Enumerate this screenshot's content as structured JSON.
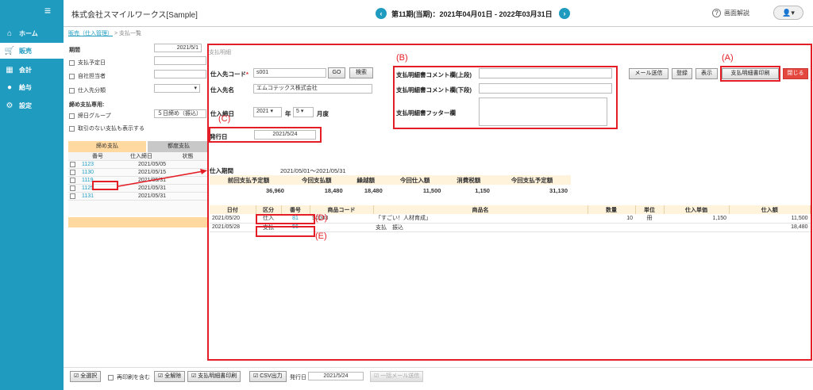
{
  "sidebar": {
    "menu_icon": "hamburger-icon",
    "items": [
      {
        "label": "ホーム",
        "icon": "home-icon"
      },
      {
        "label": "販売",
        "icon": "cart-icon"
      },
      {
        "label": "会計",
        "icon": "calculator-icon"
      },
      {
        "label": "給与",
        "icon": "moneybag-icon"
      },
      {
        "label": "設定",
        "icon": "gear-icon"
      }
    ]
  },
  "header": {
    "company": "株式会社スマイルワークス[Sample]",
    "period": "第11期(当期)：2021年04月01日 - 2022年03月31日",
    "help": "画面解説"
  },
  "breadcrumb": {
    "link": "販売（仕入管理）",
    "sep": " > ",
    "current": "支払一覧"
  },
  "filters": {
    "period_label": "期間",
    "period_value": "2021/5/1",
    "due_date_label": "支払予定日",
    "staff_label": "自社担当者",
    "category_label": "仕入先分類",
    "closing_heading": "締め支払専用:",
    "closing_group_label": "締日グループ",
    "closing_group_value": "５日締め（振込）",
    "show_no_trans_label": "取引のない支払も表示する"
  },
  "left_list": {
    "tab_active": "締め支払",
    "tab_inactive": "都度支払",
    "headers": [
      "番号",
      "仕入締日",
      "状態"
    ],
    "rows": [
      {
        "no": "1123",
        "date": "2021/05/05"
      },
      {
        "no": "1130",
        "date": "2021/05/15"
      },
      {
        "no": "1119",
        "date": "2021/05/31"
      },
      {
        "no": "1125",
        "date": "2021/05/31"
      },
      {
        "no": "1131",
        "date": "2021/05/31"
      }
    ]
  },
  "modal": {
    "title": "支払明細",
    "supplier_code_label": "仕入先コード",
    "required_mark": "*",
    "supplier_code": "s001",
    "go_btn": "GO",
    "search_btn": "検索",
    "supplier_name_label": "仕入先名",
    "supplier_name": "エムコテックス株式会社",
    "closing_label": "仕入締日",
    "year": "2021",
    "year_unit": "年",
    "month": "5",
    "month_unit": "月度",
    "issue_label": "発行日",
    "issue_date": "2021/5/24",
    "comment_upper_label": "支払明細書コメント欄(上段)",
    "comment_lower_label": "支払明細書コメント欄(下段)",
    "footer_label": "支払明細書フッター欄",
    "buttons": {
      "mail": "メール送信",
      "register": "登録",
      "display": "表示",
      "print": "支払明細書印刷",
      "close": "閉じる"
    },
    "purchase_period_label": "仕入期間",
    "purchase_period": "2021/05/01～2021/05/31",
    "summary": {
      "headers": [
        "前回支払予定額",
        "今回支払額",
        "繰越額",
        "今回仕入額",
        "消費税額",
        "今回支払予定額"
      ],
      "values": [
        "36,960",
        "18,480",
        "18,480",
        "11,500",
        "1,150",
        "31,130"
      ]
    },
    "detail": {
      "headers": [
        "日付",
        "区分",
        "番号",
        "商品コード",
        "商品名",
        "数量",
        "単位",
        "仕入単価",
        "仕入額"
      ],
      "rows": [
        {
          "date": "2021/05/20",
          "kind": "仕入",
          "no": "81",
          "code": "S0003",
          "name": "「すごい！人材育成」",
          "qty": "10",
          "unit": "冊",
          "price": "1,150",
          "amount": "11,500"
        },
        {
          "date": "2021/05/28",
          "kind": "支払",
          "no": "56",
          "code": "",
          "name": "支払　振込",
          "qty": "",
          "unit": "",
          "price": "",
          "amount": "18,480"
        }
      ]
    }
  },
  "annotations": {
    "a": "(A)",
    "b": "(B)",
    "c": "(C)",
    "d": "(D)",
    "e": "(E)"
  },
  "footer": {
    "select_all": "全選択",
    "include_reprint": "再印刷を含む",
    "deselect_all": "全解除",
    "print_btn": "支払明細書印刷",
    "csv_btn": "CSV出力",
    "issue_label": "発行日",
    "issue_value": "2021/5/24",
    "bulk_mail": "一括メール送信"
  },
  "colors": {
    "accent": "#1f9bc0",
    "annotation": "#e41e26",
    "header_bg": "#fff3dc",
    "close_btn": "#e4473e"
  }
}
